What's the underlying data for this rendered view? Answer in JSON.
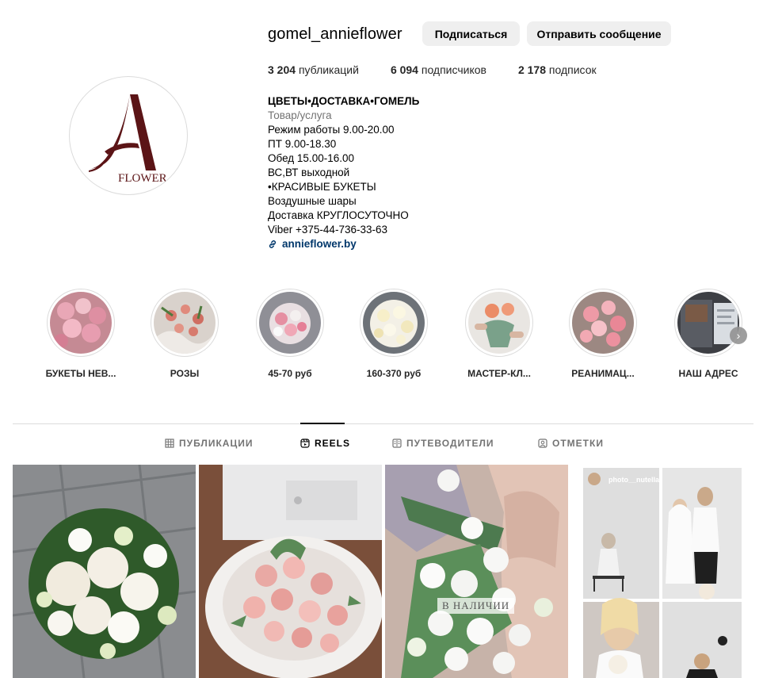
{
  "profile": {
    "username": "gomel_annieflower",
    "follow_label": "Подписаться",
    "message_label": "Отправить сообщение",
    "avatar_logo_text": "FLOWER"
  },
  "stats": {
    "posts_count": "3 204",
    "posts_label": "публикаций",
    "followers_count": "6 094",
    "followers_label": "подписчиков",
    "following_count": "2 178",
    "following_label": "подписок"
  },
  "bio": {
    "name": "ЦВЕТЫ•ДОСТАВКА•ГОМЕЛЬ",
    "category": "Товар/услуга",
    "lines": [
      "Режим работы 9.00-20.00",
      "ПТ 9.00-18.30",
      "Обед 15.00-16.00",
      "ВС,ВТ выходной",
      "•КРАСИВЫЕ БУКЕТЫ",
      "Воздушные шары",
      "Доставка КРУГЛОСУТОЧНО",
      "Viber +375-44-736-33-63"
    ],
    "link": "annieflower.by"
  },
  "highlights": [
    {
      "label": "БУКЕТЫ НЕВ..."
    },
    {
      "label": "РОЗЫ"
    },
    {
      "label": "45-70 руб"
    },
    {
      "label": "160-370 руб"
    },
    {
      "label": "МАСТЕР-КЛ..."
    },
    {
      "label": "РЕАНИМАЦ..."
    },
    {
      "label": "НАШ АДРЕС"
    }
  ],
  "tabs": [
    {
      "label": "ПУБЛИКАЦИИ",
      "icon": "grid-icon"
    },
    {
      "label": "REELS",
      "icon": "reels-icon"
    },
    {
      "label": "ПУТЕВОДИТЕЛИ",
      "icon": "guide-icon"
    },
    {
      "label": "ОТМЕТКИ",
      "icon": "tagged-icon"
    }
  ],
  "active_tab": "REELS",
  "posts": [
    {
      "overlay": ""
    },
    {
      "overlay": ""
    },
    {
      "overlay": "В НАЛИЧИИ"
    },
    {
      "overlay": "photo__nutella"
    }
  ],
  "colors": {
    "button_bg": "#efefef",
    "link": "#00376b",
    "secondary_text": "#737373",
    "logo": "#5b1416"
  }
}
